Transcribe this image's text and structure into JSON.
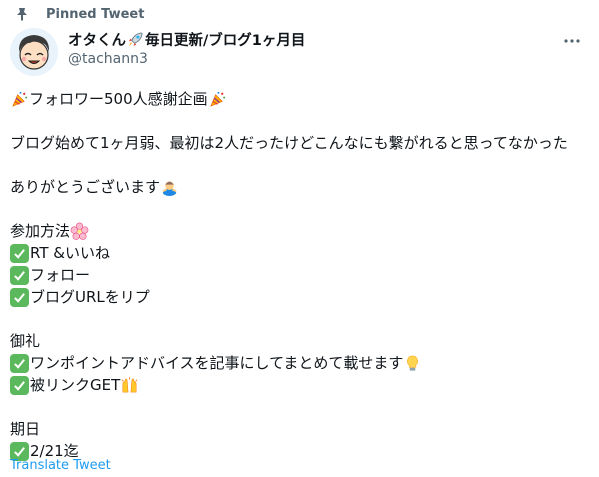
{
  "pinned": {
    "label": "Pinned Tweet",
    "icon": "pin-icon"
  },
  "author": {
    "name_prefix": "オタくん",
    "name_suffix": "毎日更新/ブログ1ヶ月目",
    "name_emoji": "rocket-icon",
    "handle": "@tachann3",
    "avatar_icon": "avatar-illustration"
  },
  "tweet": {
    "title": "フォロワー500人感謝企画",
    "title_emoji": "party-popper-icon",
    "intro": "ブログ始めて1ヶ月弱、最初は2人だったけどこんなにも繋がれると思ってなかった",
    "thanks": "ありがとうございます",
    "thanks_emoji": "bowing-person-icon",
    "how_title": "参加方法",
    "how_emoji": "cherry-blossom-icon",
    "how_items": [
      "RT &いいね",
      "フォロー",
      "ブログURLをリプ"
    ],
    "reward_title": "御礼",
    "reward_item": "ワンポイントアドバイスを記事にしてまとめて載せます",
    "reward_emoji": "light-bulb-icon",
    "reward_item2": "被リンクGET",
    "reward_item2_emoji": "raising-hands-icon",
    "deadline_title": "期日",
    "deadline": "2/21迄"
  },
  "translate_label": "Translate Tweet",
  "colors": {
    "text": "#0f1419",
    "secondary": "#536471",
    "link": "#1d9bf0",
    "check_bg": "#5cb85c"
  }
}
